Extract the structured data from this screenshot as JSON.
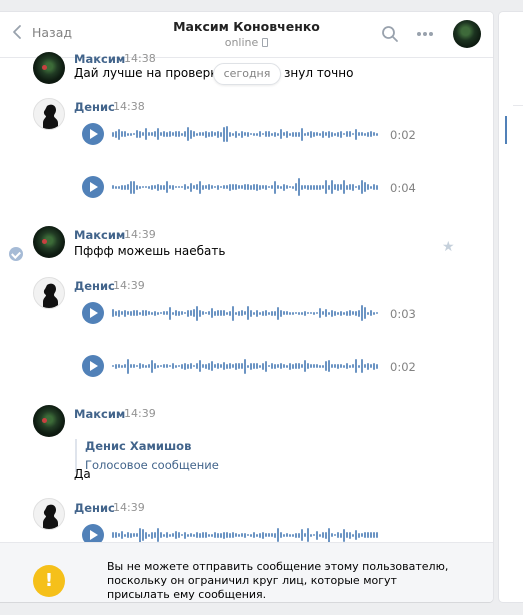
{
  "header": {
    "back_label": "Назад",
    "title": "Максим Коновченко",
    "status": "online"
  },
  "date_divider": "сегодня",
  "messages": [
    {
      "author": "Максим",
      "time": "14:38",
      "text": "Дай лучше на проверку ч",
      "text_tail": "знул точно"
    },
    {
      "author": "Денис",
      "time": "14:38",
      "voices": [
        {
          "duration": "0:02"
        },
        {
          "duration": "0:04"
        }
      ]
    },
    {
      "author": "Максим",
      "time": "14:39",
      "text": "Пффф можешь наебать"
    },
    {
      "author": "Денис",
      "time": "14:39",
      "voices": [
        {
          "duration": "0:03"
        },
        {
          "duration": "0:02"
        }
      ]
    },
    {
      "author": "Максим",
      "time": "14:39",
      "reply": {
        "name": "Денис Хамишов",
        "text": "Голосовое сообщение"
      },
      "text": "Да"
    },
    {
      "author": "Денис",
      "time": "14:39"
    }
  ],
  "notice": {
    "icon": "!",
    "text": "Вы не можете отправить сообщение этому пользователю, поскольку он ограничил круг лиц, которые могут присылать ему сообщения."
  },
  "colors": {
    "accent": "#5181b8",
    "link": "#42648b",
    "warning": "#f5c01a"
  }
}
